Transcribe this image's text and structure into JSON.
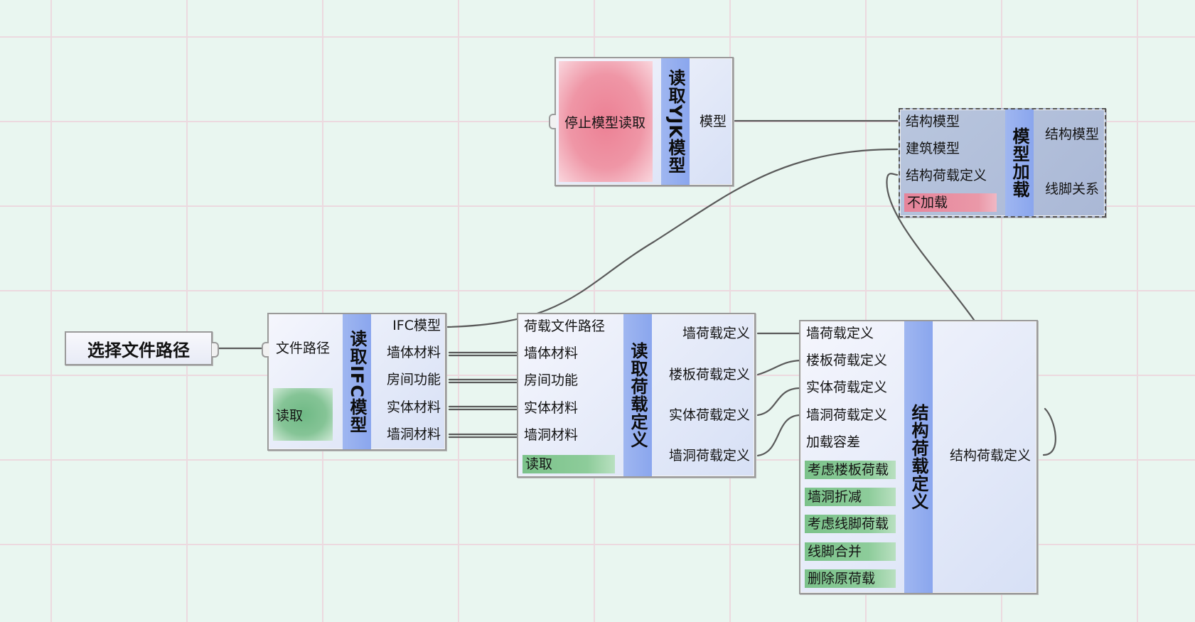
{
  "colors": {
    "canvas": "#e9f6f0",
    "grid": "#ecd9df",
    "node_fill": "#e3e9f8",
    "title_bar": "#8aa6ee",
    "green_control": "#85c496",
    "red_control": "#ef96a6",
    "wire": "#5a5a5a"
  },
  "nodes": {
    "select_path": {
      "label": "选择文件路径"
    },
    "read_ifc": {
      "title": "读取IFC模型",
      "inputs": [
        "文件路径"
      ],
      "button": "读取",
      "outputs": [
        "IFC模型",
        "墙体材料",
        "房间功能",
        "实体材料",
        "墙洞材料"
      ]
    },
    "read_load_def": {
      "title": "读取荷载定义",
      "inputs": [
        "荷载文件路径",
        "墙体材料",
        "房间功能",
        "实体材料",
        "墙洞材料"
      ],
      "toggle": "读取",
      "outputs": [
        "墙荷载定义",
        "楼板荷载定义",
        "实体荷载定义",
        "墙洞荷载定义"
      ]
    },
    "read_yjk": {
      "title": "读取YJK模型",
      "button": "停止模型读取",
      "outputs": [
        "模型"
      ]
    },
    "model_load": {
      "title": "模型加载",
      "inputs": [
        "结构模型",
        "建筑模型",
        "结构荷载定义"
      ],
      "toggle": "不加载",
      "outputs": [
        "结构模型",
        "线脚关系"
      ]
    },
    "struct_load_def": {
      "title": "结构荷载定义",
      "inputs": [
        "墙荷载定义",
        "楼板荷载定义",
        "实体荷载定义",
        "墙洞荷载定义",
        "加载容差"
      ],
      "toggles": [
        "考虑楼板荷载",
        "墙洞折减",
        "考虑线脚荷载",
        "线脚合并",
        "删除原荷载"
      ],
      "outputs": [
        "结构荷载定义"
      ]
    }
  }
}
